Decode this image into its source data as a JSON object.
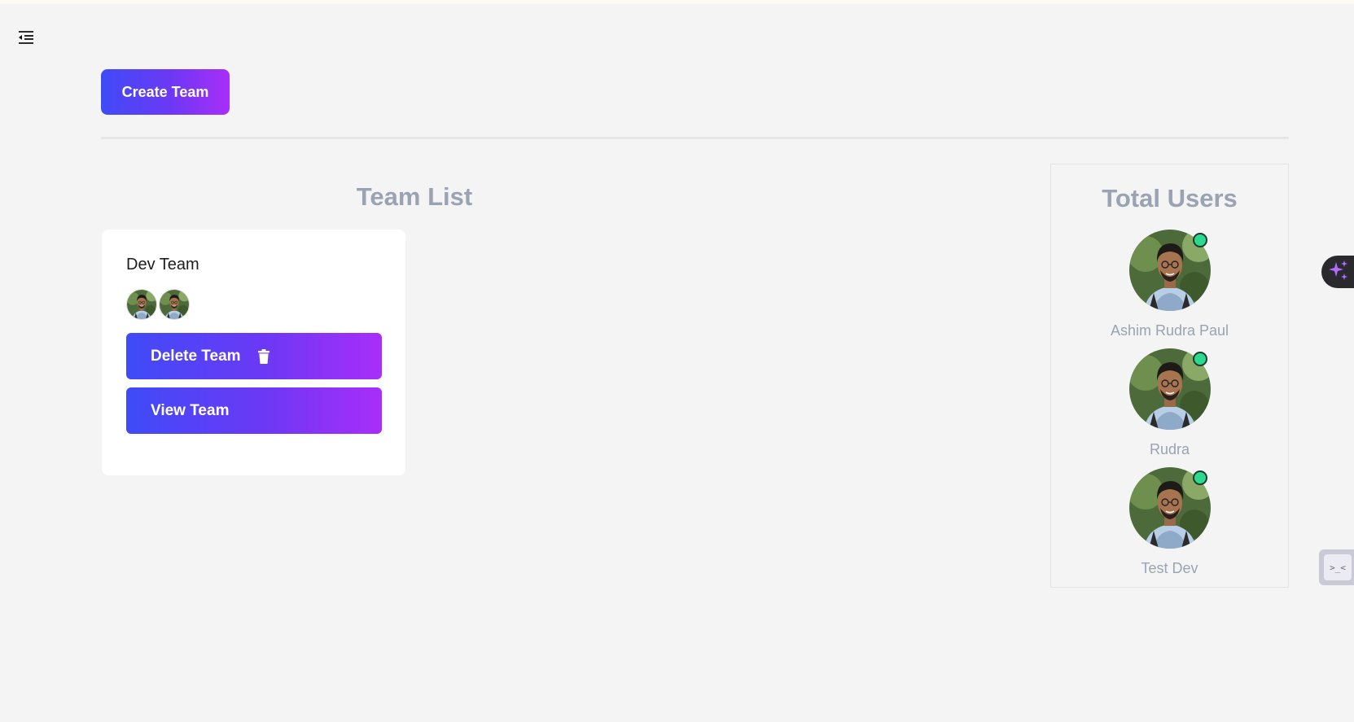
{
  "header": {
    "menu_icon": "indent-menu-icon",
    "create_button_label": "Create Team"
  },
  "team_list": {
    "title": "Team List",
    "teams": [
      {
        "name": "Dev Team",
        "member_count": 2,
        "delete_label": "Delete Team",
        "delete_icon": "trash-icon",
        "view_label": "View Team"
      }
    ]
  },
  "users_panel": {
    "title": "Total Users",
    "users": [
      {
        "name": "Ashim Rudra Paul",
        "status": "online"
      },
      {
        "name": "Rudra",
        "status": "online"
      },
      {
        "name": "Test Dev",
        "status": "online"
      }
    ]
  },
  "floating": {
    "ai_icon": "sparkle-icon",
    "console_icon": "console-icon",
    "console_glyph": ">_<"
  },
  "colors": {
    "background": "#f4f4f4",
    "gradient_start": "#3f4bf7",
    "gradient_end": "#a92ef9",
    "heading_gray": "#9aa3b2",
    "online_green": "#2bd98f"
  }
}
